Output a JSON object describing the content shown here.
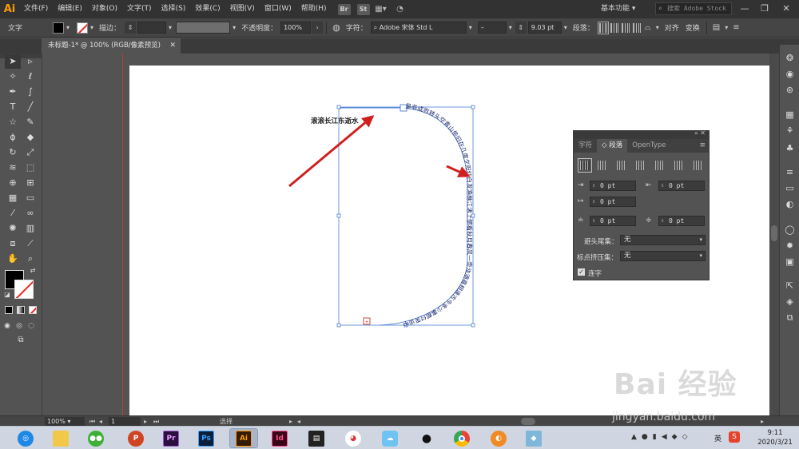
{
  "app": {
    "logo": "Ai",
    "menu": [
      "文件(F)",
      "编辑(E)",
      "对象(O)",
      "文字(T)",
      "选择(S)",
      "效果(C)",
      "视图(V)",
      "窗口(W)",
      "帮助(H)"
    ],
    "bridge_labels": [
      "Br",
      "St"
    ],
    "workspace": "基本功能 ▾",
    "stock_search_placeholder": "搜索 Adobe Stock",
    "window_controls": [
      "—",
      "❐",
      "✕"
    ]
  },
  "control_bar": {
    "tool_label": "文字",
    "stroke_label": "描边：",
    "opacity_label": "不透明度：",
    "opacity_value": "100%",
    "char_label": "字符：",
    "font_name": "Adobe 宋体 Std L",
    "font_style": "–",
    "font_size": "9.03 pt",
    "paragraph_label": "段落：",
    "align_label": "对齐",
    "transform_label": "变换"
  },
  "document": {
    "tab_title": "未标题-1* @ 100% (RGB/像素预览)",
    "close": "✕"
  },
  "canvas": {
    "label_text": "滚滚长江东逝水",
    "path_text": "是非成败转头空青山依旧在几度夕阳红白发渔樵江渚上惯看秋月春风一壶浊酒喜相逢古今多少事都付笑谈中"
  },
  "paragraph_panel": {
    "tabs": [
      "字符",
      "◇ 段落",
      "OpenType"
    ],
    "active_tab": 1,
    "menu_icon": "≡",
    "collapse_icons": "«  ✕",
    "indent_fields": [
      "0 pt",
      "0 pt",
      "0 pt",
      "0 pt",
      "0 pt"
    ],
    "kinsoku_label": "避头尾集：",
    "kinsoku_value": "无",
    "mojikumi_label": "标点挤压集：",
    "mojikumi_value": "无",
    "hyphenate_label": "连字",
    "hyphenate_checked": true
  },
  "status_bar": {
    "zoom": "100%",
    "artboard_num": "1",
    "tool_name": "选择"
  },
  "taskbar": {
    "apps": [
      "",
      "",
      "",
      "P",
      "Pr",
      "Ps",
      "Ai",
      "Id",
      "",
      "",
      "",
      "",
      "",
      "",
      ""
    ],
    "ime": "英",
    "time": "9:11",
    "date": "2020/3/21"
  },
  "watermark": {
    "logo": "Bai 经验",
    "url": "jingyan.baidu.com"
  }
}
